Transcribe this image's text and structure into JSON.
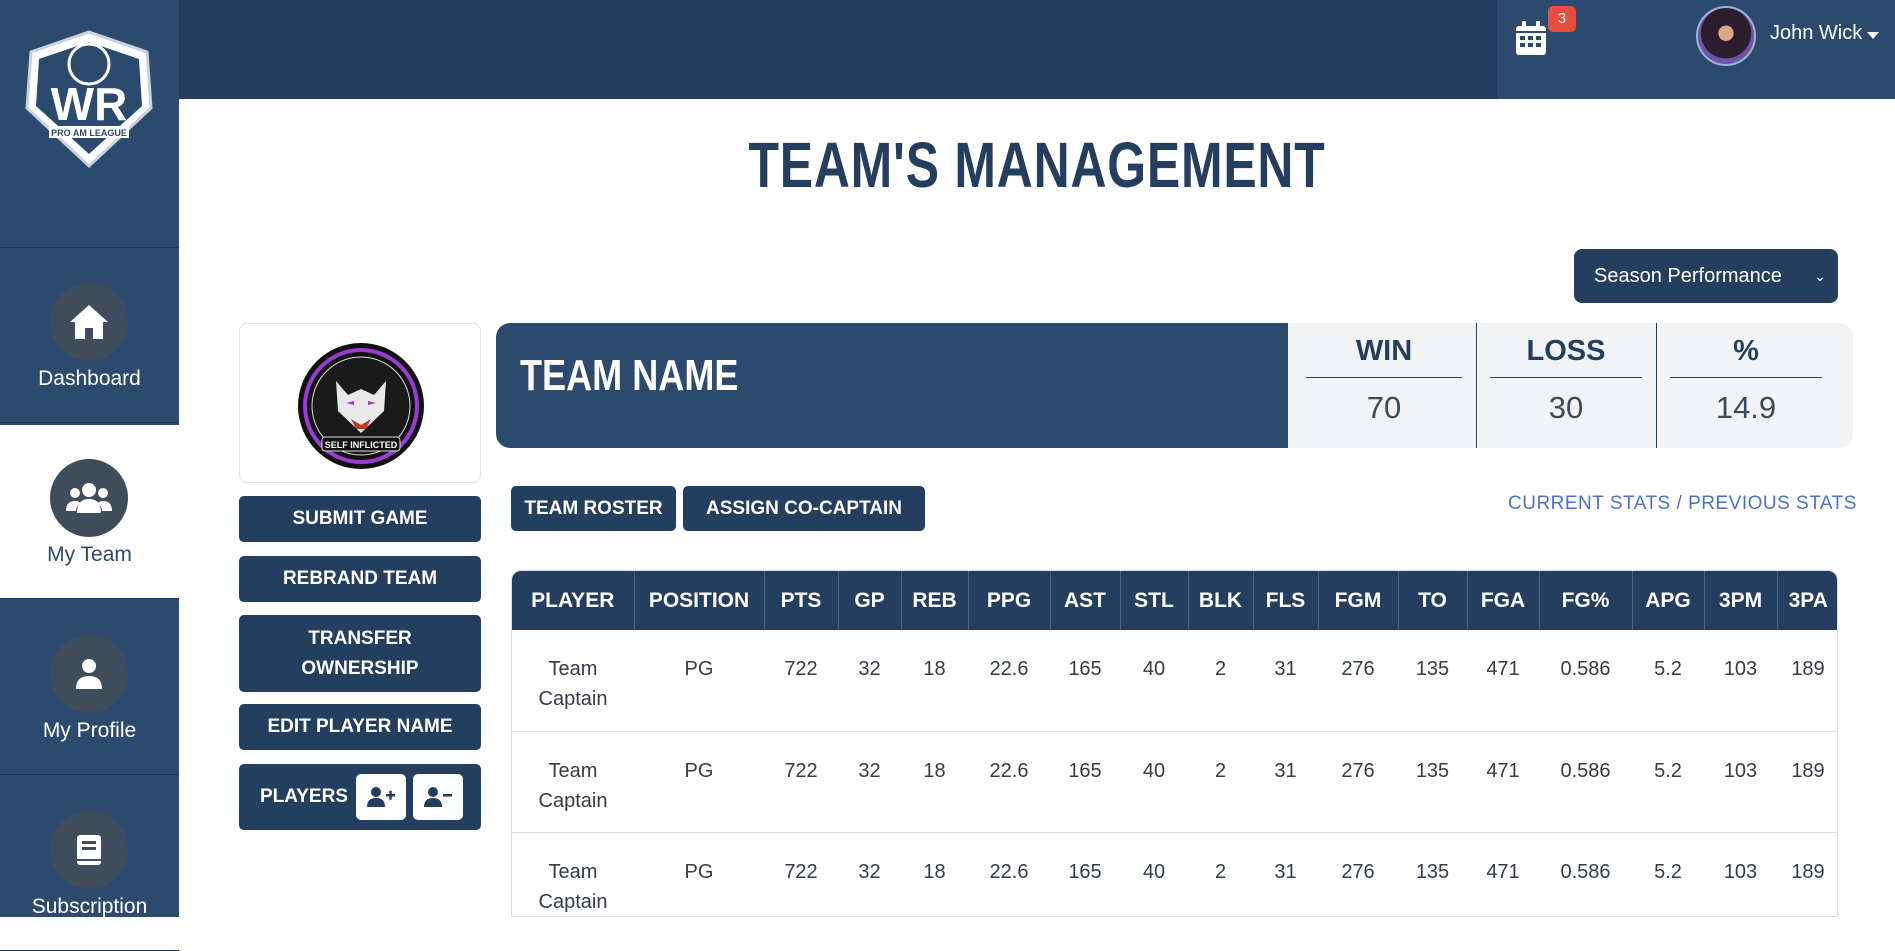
{
  "sidebar": {
    "logo_text": "WR",
    "logo_subtext": "PRO AM LEAGUE",
    "items": [
      {
        "label": "Dashboard",
        "icon": "home-icon"
      },
      {
        "label": "My Team",
        "icon": "users-icon",
        "active": true
      },
      {
        "label": "My Profile",
        "icon": "user-icon"
      },
      {
        "label": "Subscription",
        "icon": "book-icon"
      }
    ]
  },
  "header": {
    "notification_count": "3",
    "user_name": "John Wick"
  },
  "page": {
    "title": "TEAM'S MANAGEMENT",
    "performance_select": "Season Performance"
  },
  "team": {
    "logo_text": "SELF INFLICTED",
    "name": "TEAM NAME",
    "win_label": "WIN",
    "win_value": "70",
    "loss_label": "LOSS",
    "loss_value": "30",
    "pct_label": "%",
    "pct_value": "14.9"
  },
  "actions": {
    "submit_game": "SUBMIT GAME",
    "rebrand_team": "REBRAND TEAM",
    "transfer_ownership": "TRANSFER OWNERSHIP",
    "edit_player_name": "EDIT PLAYER NAME",
    "players": "PLAYERS"
  },
  "tabs": {
    "team_roster": "TEAM ROSTER",
    "assign_co_captain": "ASSIGN CO-CAPTAIN",
    "current_stats": "CURRENT STATS",
    "separator": " / ",
    "previous_stats": "PREVIOUS STATS"
  },
  "table": {
    "columns": [
      "PLAYER",
      "POSITION",
      "PTS",
      "GP",
      "REB",
      "PPG",
      "AST",
      "STL",
      "BLK",
      "FLS",
      "FGM",
      "TO",
      "FGA",
      "FG%",
      "APG",
      "3PM",
      "3PA"
    ],
    "rows": [
      [
        "Team Captain",
        "PG",
        "722",
        "32",
        "18",
        "22.6",
        "165",
        "40",
        "2",
        "31",
        "276",
        "135",
        "471",
        "0.586",
        "5.2",
        "103",
        "189"
      ],
      [
        "Team Captain",
        "PG",
        "722",
        "32",
        "18",
        "22.6",
        "165",
        "40",
        "2",
        "31",
        "276",
        "135",
        "471",
        "0.586",
        "5.2",
        "103",
        "189"
      ],
      [
        "Team Captain",
        "PG",
        "722",
        "32",
        "18",
        "22.6",
        "165",
        "40",
        "2",
        "31",
        "276",
        "135",
        "471",
        "0.586",
        "5.2",
        "103",
        "189"
      ]
    ]
  },
  "colors": {
    "navy": "#243e5f",
    "sidebar": "#2b4a6e",
    "badge": "#e74c3c",
    "link": "#4a72c8"
  }
}
